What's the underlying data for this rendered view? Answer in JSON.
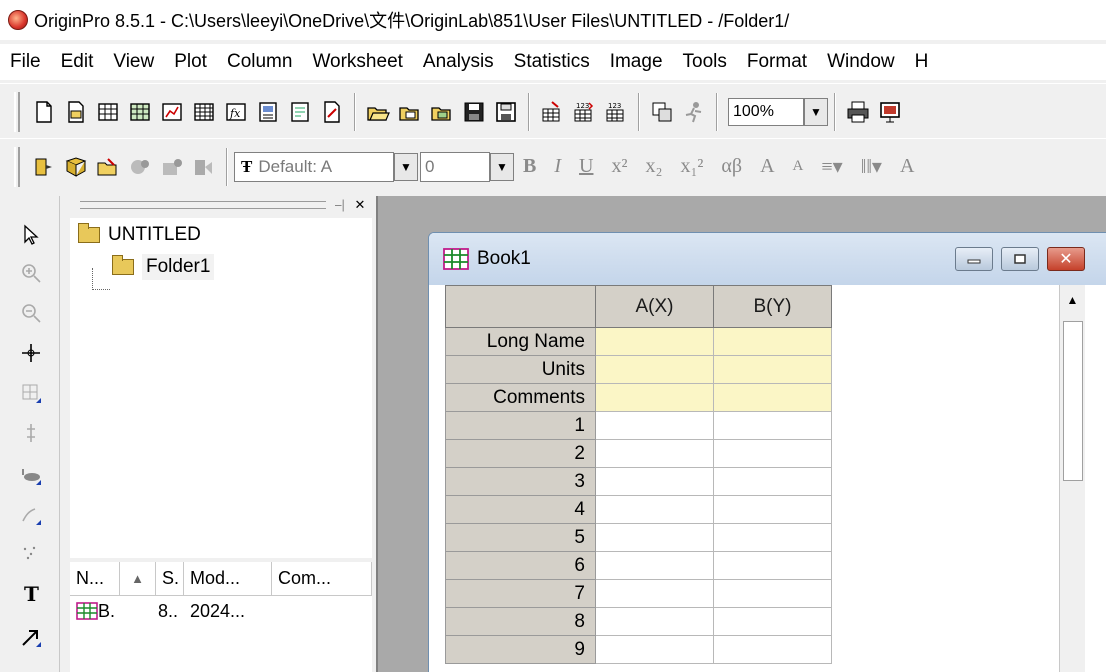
{
  "window": {
    "title": "OriginPro 8.5.1 - C:\\Users\\leeyi\\OneDrive\\文件\\OriginLab\\851\\User Files\\UNTITLED - /Folder1/"
  },
  "menu": [
    "File",
    "Edit",
    "View",
    "Plot",
    "Column",
    "Worksheet",
    "Analysis",
    "Statistics",
    "Image",
    "Tools",
    "Format",
    "Window",
    "H"
  ],
  "toolbar_standard": {
    "zoom": "100%"
  },
  "toolbar_format": {
    "font": "Default: A",
    "size": "0",
    "labels": [
      "B",
      "I",
      "U",
      "x²",
      "x₂",
      "x₁²",
      "αβ",
      "A",
      "A"
    ]
  },
  "explorer": {
    "root": "UNTITLED",
    "folder": "Folder1",
    "list_columns": [
      "N...",
      "▲",
      "S.",
      "Mod...",
      "Com..."
    ],
    "list_rows": [
      {
        "name": "B.",
        "size": "8..",
        "modified": "2024..."
      }
    ]
  },
  "book": {
    "title": "Book1",
    "columns": [
      "A(X)",
      "B(Y)"
    ],
    "row_labels": [
      "Long Name",
      "Units",
      "Comments"
    ],
    "rows": [
      "1",
      "2",
      "3",
      "4",
      "5",
      "6",
      "7",
      "8",
      "9"
    ]
  }
}
